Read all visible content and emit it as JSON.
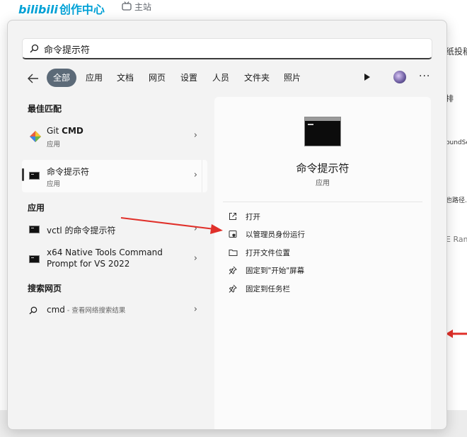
{
  "background_page": {
    "logo_text": "bilibili",
    "logo_cn": "创作中心",
    "main_site": "主站",
    "right_snippets": [
      "纸投稿",
      "排",
      "oundSe",
      "也路径.t",
      "E Ram"
    ]
  },
  "search": {
    "value": "命令提示符"
  },
  "filters": {
    "chips": [
      {
        "label": "全部",
        "active": true
      },
      {
        "label": "应用",
        "active": false
      },
      {
        "label": "文档",
        "active": false
      },
      {
        "label": "网页",
        "active": false
      },
      {
        "label": "设置",
        "active": false
      },
      {
        "label": "人员",
        "active": false
      },
      {
        "label": "文件夹",
        "active": false
      },
      {
        "label": "照片",
        "active": false
      }
    ],
    "more": "···"
  },
  "results": {
    "best_match_title": "最佳匹配",
    "best_match": [
      {
        "title_prefix": "Git ",
        "title_bold": "CMD",
        "subtitle": "应用"
      },
      {
        "title": "命令提示符",
        "subtitle": "应用"
      }
    ],
    "apps_title": "应用",
    "apps": [
      {
        "title": "vctl 的命令提示符"
      },
      {
        "title_line1": "x64 Native Tools Command",
        "title_line2": "Prompt for VS 2022"
      }
    ],
    "web_title": "搜索网页",
    "web": {
      "query": "cmd",
      "suffix": " - 查看网络搜索结果"
    }
  },
  "detail": {
    "title": "命令提示符",
    "subtitle": "应用",
    "actions": [
      {
        "label": "打开",
        "icon": "open-external-icon"
      },
      {
        "label": "以管理员身份运行",
        "icon": "shield-icon"
      },
      {
        "label": "打开文件位置",
        "icon": "folder-icon"
      },
      {
        "label": "固定到\"开始\"屏幕",
        "icon": "pin-icon"
      },
      {
        "label": "固定到任务栏",
        "icon": "pin-icon"
      }
    ]
  },
  "colors": {
    "active_chip": "#5c6a78",
    "arrow": "#e0302a",
    "bili_blue": "#00a1d6"
  }
}
